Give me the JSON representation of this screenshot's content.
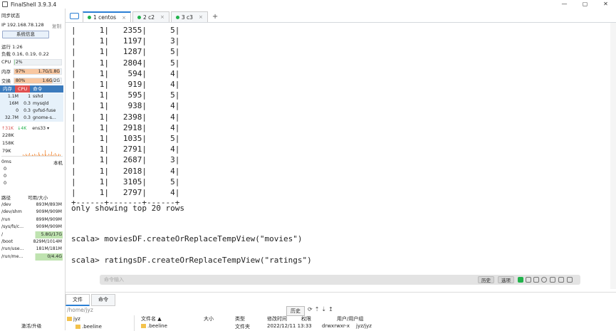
{
  "app": {
    "title": "FinalShell 3.9.3.4"
  },
  "window": {
    "min": "—",
    "max": "▢",
    "close": "✕"
  },
  "sidebar": {
    "sync_status": "同步状态",
    "ip_label": "IP 192.168.78.128",
    "copy": "复制",
    "sysinfo_button": "系统信息",
    "uptime": "运行 1:26",
    "load": "负载 0.16, 0.19, 0.22",
    "cpu": {
      "label": "CPU",
      "pct": "2%",
      "fraction": 0.02
    },
    "mem": {
      "label": "内存",
      "pct": "97%",
      "val": "1.7G/1.8G",
      "fraction": 0.97
    },
    "swap": {
      "label": "交换",
      "pct": "80%",
      "val": "1.6G/2G",
      "fraction": 0.8
    },
    "proc_tabs": [
      "内存",
      "CPU",
      "命令"
    ],
    "processes": [
      {
        "mem": "1.1M",
        "cpu": "1",
        "name": "sshd"
      },
      {
        "mem": "16M",
        "cpu": "0.3",
        "name": "mysqld"
      },
      {
        "mem": "0",
        "cpu": "0.3",
        "name": "gvfsd-fuse"
      },
      {
        "mem": "32.7M",
        "cpu": "0.3",
        "name": "gnome-s..."
      }
    ],
    "net": {
      "up": "↑31K",
      "down": "↓4K",
      "iface": "ens33 ▾",
      "ticks": [
        "228K",
        "158K",
        "79K"
      ]
    },
    "ping": {
      "ms": "0ms",
      "host": "本机",
      "values": [
        "0",
        "0",
        "0"
      ]
    },
    "disk_header": {
      "path": "路径",
      "size": "可用/大小"
    },
    "disks": [
      {
        "path": "/dev",
        "size": "893M/893M"
      },
      {
        "path": "/dev/shm",
        "size": "909M/909M"
      },
      {
        "path": "/run",
        "size": "899M/909M"
      },
      {
        "path": "/sys/fs/c...",
        "size": "909M/909M"
      },
      {
        "path": "/",
        "size": "5.8G/17G"
      },
      {
        "path": "/boot",
        "size": "829M/1014M"
      },
      {
        "path": "/run/use...",
        "size": "181M/181M"
      },
      {
        "path": "/run/me...",
        "size": "0/4.4G"
      }
    ],
    "upgrade": "激活/升级"
  },
  "tabs": [
    {
      "label": "1 centos",
      "close": "×"
    },
    {
      "label": "2 c2",
      "close": "×"
    },
    {
      "label": "3 c3",
      "close": "×"
    }
  ],
  "add_tab": "+",
  "terminal": {
    "rows": [
      "|     1|   2355|     5|",
      "|     1|   1197|     3|",
      "|     1|   1287|     5|",
      "|     1|   2804|     5|",
      "|     1|    594|     4|",
      "|     1|    919|     4|",
      "|     1|    595|     5|",
      "|     1|    938|     4|",
      "|     1|   2398|     4|",
      "|     1|   2918|     4|",
      "|     1|   1035|     5|",
      "|     1|   2791|     4|",
      "|     1|   2687|     3|",
      "|     1|   2018|     4|",
      "|     1|   3105|     5|",
      "|     1|   2797|     4|"
    ],
    "border": "+------+-------+------+",
    "footer": "only showing top 20 rows",
    "cmd1": "scala> moviesDF.createOrReplaceTempView(\"movies\")",
    "cmd2": "scala> ratingsDF.createOrReplaceTempView(\"ratings\")"
  },
  "command_bar": {
    "placeholder": "命令输入",
    "history": "历史",
    "options": "选项"
  },
  "bottom": {
    "tabs": [
      "文件",
      "命令"
    ],
    "path": "/home/jyz",
    "history": "历史",
    "tree": [
      "jyz",
      ".beeline"
    ],
    "columns": [
      "文件名 ▲",
      "大小",
      "类型",
      "修改时间",
      "权限",
      "用户/用户组"
    ],
    "files": [
      {
        "name": ".beeline",
        "size": "",
        "type": "文件夹",
        "mtime": "2022/12/11 13:33",
        "perm": "drwxrwxr-x",
        "owner": "jyz/jyz"
      }
    ]
  },
  "colors": {
    "accent": "#2a7fd4",
    "mem_bar": "#f4a261",
    "swap_bar": "#f4a261",
    "cpu_bar": "#9cd49c",
    "active_green": "#21b24b"
  }
}
